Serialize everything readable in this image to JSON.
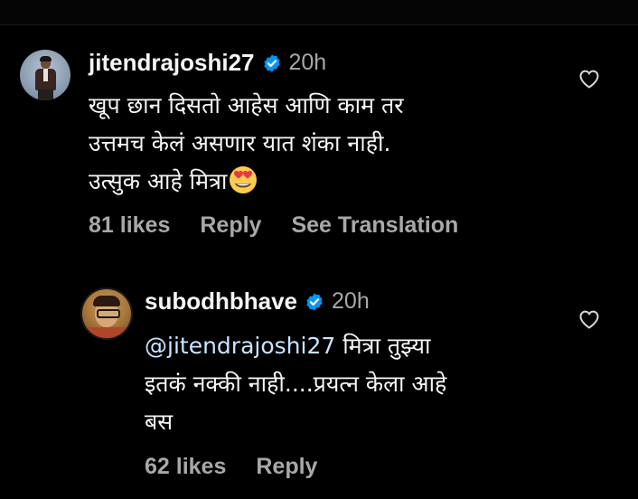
{
  "comments": [
    {
      "username": "jitendrajoshi27",
      "verified": true,
      "time": "20h",
      "lines": [
        "खूप छान दिसतो आहेस आणि काम तर",
        "उत्तमच केलं असणार यात शंका नाही.",
        "उत्सुक आहे मित्रा"
      ],
      "emoji": "smiling-face-with-heart-eyes",
      "likes": "81 likes",
      "reply_label": "Reply",
      "translation_label": "See Translation"
    },
    {
      "username": "subodhbhave",
      "verified": true,
      "time": "20h",
      "mention": "@jitendrajoshi27",
      "lines": [
        " मित्रा तुझ्या",
        "इतकं नक्की नाही....प्रयत्न केला आहे",
        "बस"
      ],
      "likes": "62 likes",
      "reply_label": "Reply"
    }
  ],
  "colors": {
    "background": "#000000",
    "primary_text": "#f5f5f5",
    "secondary_text": "#a8a8a8",
    "verified_badge": "#0095f6",
    "mention": "#c9e4ff"
  },
  "icons": {
    "like": "heart-outline-icon",
    "verified": "verified-badge-icon",
    "emoji": "smiling-face-with-heart-eyes"
  }
}
